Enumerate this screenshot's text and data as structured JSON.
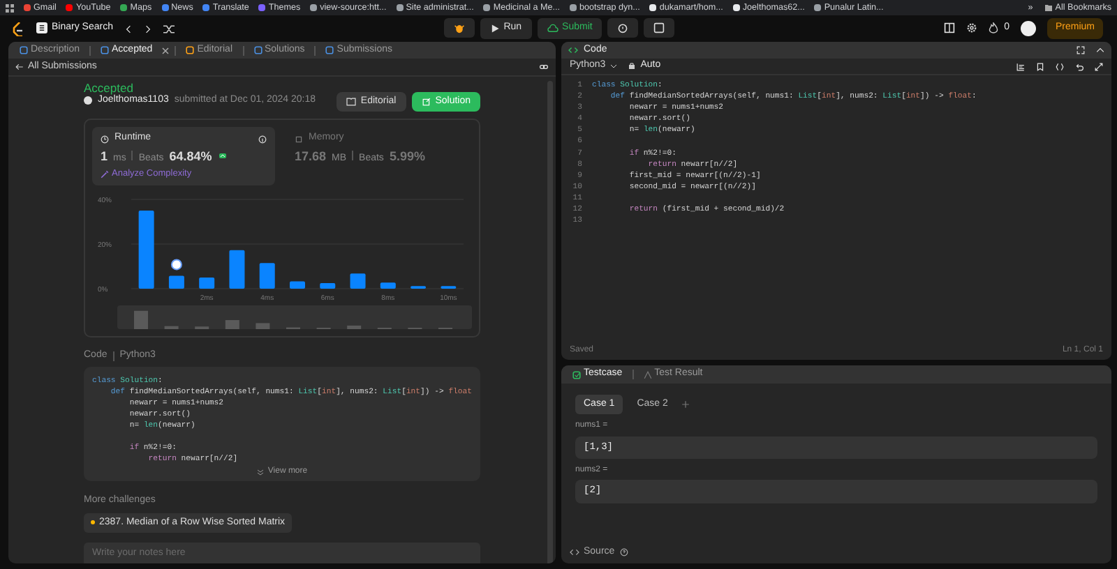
{
  "bookmarks_bar": {
    "items": [
      {
        "label": "Gmail",
        "color": "#ea4335"
      },
      {
        "label": "YouTube",
        "color": "#ff0000"
      },
      {
        "label": "Maps",
        "color": "#34a853"
      },
      {
        "label": "News",
        "color": "#4285f4"
      },
      {
        "label": "Translate",
        "color": "#4285f4"
      },
      {
        "label": "Themes",
        "color": "#7b61ff"
      },
      {
        "label": "view-source:htt...",
        "color": "#9aa0a6"
      },
      {
        "label": "Site administrat...",
        "color": "#9aa0a6"
      },
      {
        "label": "Medicinal a Me...",
        "color": "#9aa0a6"
      },
      {
        "label": "bootstrap dyn...",
        "color": "#9aa0a6"
      },
      {
        "label": "dukamart/hom...",
        "color": "#e8eaed"
      },
      {
        "label": "Joelthomas62...",
        "color": "#e8eaed"
      },
      {
        "label": "Punalur Latin...",
        "color": "#9aa0a6"
      }
    ],
    "overflow": "»",
    "all_bookmarks": "All Bookmarks"
  },
  "toolbar": {
    "problem_list": "Binary Search",
    "run": "Run",
    "submit": "Submit",
    "streak": "0",
    "premium": "Premium"
  },
  "left_panel": {
    "tabs": [
      {
        "label": "Description",
        "selected": false,
        "closable": false
      },
      {
        "label": "Accepted",
        "selected": true,
        "closable": true
      },
      {
        "label": "Editorial",
        "selected": false,
        "closable": false
      },
      {
        "label": "Solutions",
        "selected": false,
        "closable": false
      },
      {
        "label": "Submissions",
        "selected": false,
        "closable": false
      }
    ],
    "back_link": "All Submissions",
    "submission": {
      "status": "Accepted",
      "user": "Joelthomas1103",
      "submitted": "submitted at Dec 01, 2024 20:18",
      "buttons": [
        {
          "label": "Editorial",
          "kind": "secondary"
        },
        {
          "label": "Solution",
          "kind": "primary"
        }
      ],
      "stats": [
        {
          "title": "Runtime",
          "value": "1",
          "unit": "ms",
          "beats_label": "Beats",
          "beats": "64.84%",
          "selected": true,
          "link": "Analyze Complexity"
        },
        {
          "title": "Memory",
          "value": "17.68",
          "unit": "MB",
          "beats_label": "Beats",
          "beats": "5.99%",
          "selected": false
        }
      ],
      "chart_data": {
        "type": "bar",
        "x": [
          0,
          1,
          2,
          3,
          4,
          5,
          6,
          7,
          8,
          9,
          10
        ],
        "series": [
          {
            "color": "#0a84ff",
            "values": [
              35,
              5.8,
              5,
              17.3,
              11.5,
              3.3,
              2.5,
              6.8,
              2.7,
              1.2,
              1.2
            ]
          }
        ],
        "xlim": [
          -0.5,
          10.5
        ],
        "xticks": [
          {
            "value": 2,
            "label": "2ms"
          },
          {
            "value": 4,
            "label": "4ms"
          },
          {
            "value": 6,
            "label": "6ms"
          },
          {
            "value": 8,
            "label": "8ms"
          },
          {
            "value": 10,
            "label": "10ms"
          }
        ],
        "ylim": [
          0,
          40
        ],
        "yticks": [
          {
            "value": 0,
            "label": "0%"
          },
          {
            "value": 20,
            "label": "20%"
          },
          {
            "value": 40,
            "label": "40%"
          }
        ]
      }
    },
    "code": {
      "label": "Code",
      "language": "Python3",
      "view_more": "View more",
      "lines": [
        {
          "kind": "code",
          "tokens": [
            {
              "kind": "keyword",
              "text": "class"
            },
            {
              "kind": "type",
              "text": " Solution"
            },
            {
              "kind": "plain",
              "text": ":"
            }
          ]
        },
        {
          "kind": "code",
          "tokens": [
            {
              "kind": "keyword",
              "text": "    def"
            },
            {
              "kind": "plain",
              "text": " findMedianSortedArrays(self, nums1: "
            },
            {
              "kind": "type",
              "text": "List"
            },
            {
              "kind": "plain",
              "text": "["
            },
            {
              "kind": "builtin",
              "text": "int"
            },
            {
              "kind": "plain",
              "text": "], nums2: "
            },
            {
              "kind": "type",
              "text": "List"
            },
            {
              "kind": "plain",
              "text": "["
            },
            {
              "kind": "builtin",
              "text": "int"
            },
            {
              "kind": "plain",
              "text": "]) -> "
            },
            {
              "kind": "builtin",
              "text": "float"
            }
          ]
        },
        {
          "kind": "code",
          "tokens": [
            {
              "kind": "plain",
              "text": "        newarr = nums1+nums2"
            }
          ]
        },
        {
          "kind": "code",
          "tokens": [
            {
              "kind": "plain",
              "text": "        newarr.sort()"
            }
          ]
        },
        {
          "kind": "code",
          "tokens": [
            {
              "kind": "plain",
              "text": "        n= "
            },
            {
              "kind": "type",
              "text": "len"
            },
            {
              "kind": "plain",
              "text": "(newarr)"
            }
          ]
        },
        {
          "kind": "blank"
        },
        {
          "kind": "code",
          "tokens": [
            {
              "kind": "control",
              "text": "        if"
            },
            {
              "kind": "plain",
              "text": " n%2!=0:"
            }
          ]
        },
        {
          "kind": "code",
          "tokens": [
            {
              "kind": "control",
              "text": "            return"
            },
            {
              "kind": "plain",
              "text": " newarr[n//2]"
            }
          ]
        }
      ]
    },
    "more_challenges": {
      "title": "More challenges",
      "items": [
        {
          "label": "2387. Median of a Row Wise Sorted Matrix",
          "color": "#ffb800"
        }
      ]
    },
    "notes": {
      "placeholder": "Write your notes here"
    }
  },
  "code_panel": {
    "title": "Code",
    "language": "Python3",
    "mode": "Auto",
    "status": "Saved",
    "cursor": "Ln 1, Col 1",
    "lines": [
      {
        "number": "1",
        "tokens": [
          {
            "kind": "keyword",
            "text": "class"
          },
          {
            "kind": "type",
            "text": " Solution"
          },
          {
            "kind": "plain",
            "text": ":"
          }
        ]
      },
      {
        "number": "2",
        "tokens": [
          {
            "kind": "keyword",
            "text": "    def"
          },
          {
            "kind": "plain",
            "text": " findMedianSortedArrays(self, nums1: "
          },
          {
            "kind": "type",
            "text": "List"
          },
          {
            "kind": "plain",
            "text": "["
          },
          {
            "kind": "builtin",
            "text": "int"
          },
          {
            "kind": "plain",
            "text": "], nums2: "
          },
          {
            "kind": "type",
            "text": "List"
          },
          {
            "kind": "plain",
            "text": "["
          },
          {
            "kind": "builtin",
            "text": "int"
          },
          {
            "kind": "plain",
            "text": "]) -> "
          },
          {
            "kind": "builtin",
            "text": "float"
          },
          {
            "kind": "plain",
            "text": ":"
          }
        ]
      },
      {
        "number": "3",
        "tokens": [
          {
            "kind": "plain",
            "text": "        newarr = nums1+nums2"
          }
        ]
      },
      {
        "number": "4",
        "tokens": [
          {
            "kind": "plain",
            "text": "        newarr.sort()"
          }
        ]
      },
      {
        "number": "5",
        "tokens": [
          {
            "kind": "plain",
            "text": "        n= "
          },
          {
            "kind": "type",
            "text": "len"
          },
          {
            "kind": "plain",
            "text": "(newarr)"
          }
        ]
      },
      {
        "number": "6"
      },
      {
        "number": "7",
        "tokens": [
          {
            "kind": "control",
            "text": "        if"
          },
          {
            "kind": "plain",
            "text": " n%2!=0:"
          }
        ]
      },
      {
        "number": "8",
        "tokens": [
          {
            "kind": "control",
            "text": "            return"
          },
          {
            "kind": "plain",
            "text": " newarr[n//2]"
          }
        ]
      },
      {
        "number": "9",
        "tokens": [
          {
            "kind": "plain",
            "text": "        first_mid = newarr[(n//2)-1]"
          }
        ]
      },
      {
        "number": "10",
        "tokens": [
          {
            "kind": "plain",
            "text": "        second_mid = newarr[(n//2)]"
          }
        ]
      },
      {
        "number": "11"
      },
      {
        "number": "12",
        "tokens": [
          {
            "kind": "control",
            "text": "        return"
          },
          {
            "kind": "plain",
            "text": " (first_mid + second_mid)/2"
          }
        ]
      },
      {
        "number": "13"
      }
    ]
  },
  "test_panel": {
    "tabs": [
      {
        "label": "Testcase",
        "selected": true
      },
      {
        "label": "Test Result",
        "selected": false
      }
    ],
    "cases": [
      {
        "label": "Case 1",
        "selected": true
      },
      {
        "label": "Case 2",
        "selected": false
      }
    ],
    "inputs": [
      {
        "label": "nums1 =",
        "value": "[1,3]"
      },
      {
        "label": "nums2 =",
        "value": "[2]"
      }
    ],
    "source": "Source"
  }
}
